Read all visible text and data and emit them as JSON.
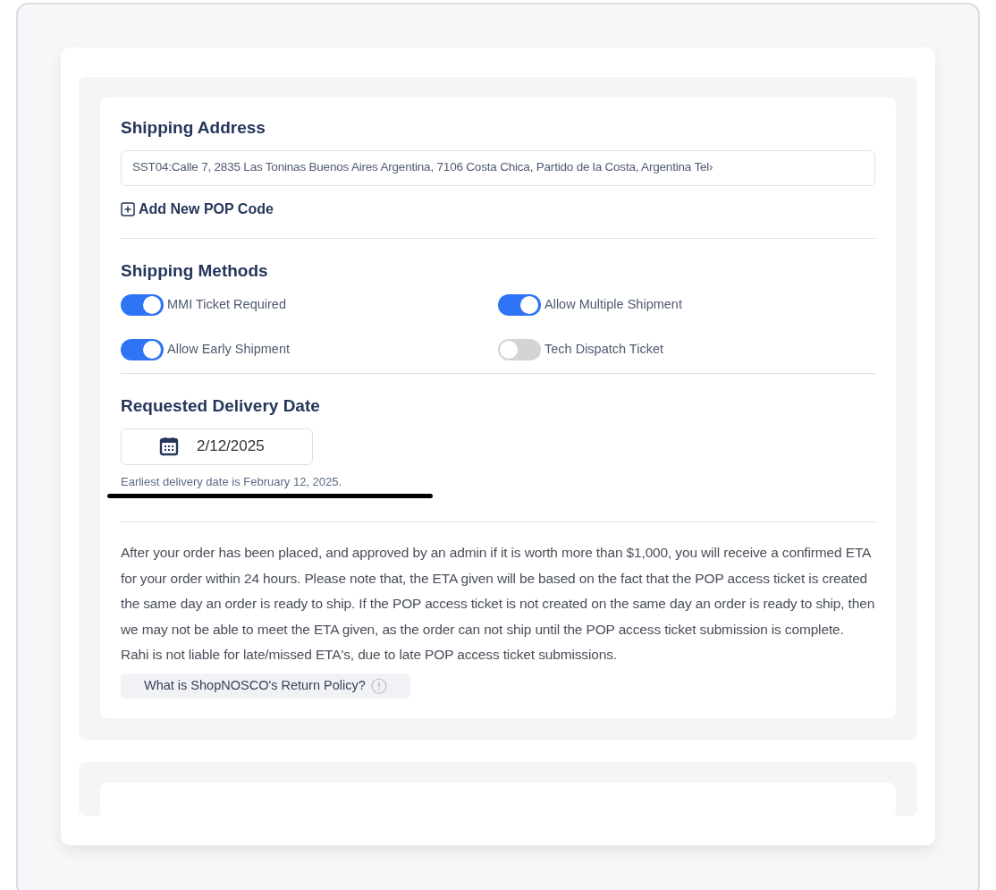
{
  "shipping_address": {
    "title": "Shipping Address",
    "value": "SST04:Calle 7, 2835 Las Toninas Buenos Aires Argentina, 7106 Costa Chica, Partido de la Costa, Argentina Tel›",
    "add_link": "Add New POP Code"
  },
  "shipping_methods": {
    "title": "Shipping Methods",
    "options": [
      {
        "label": "MMI Ticket Required",
        "on": true
      },
      {
        "label": "Allow Multiple Shipment",
        "on": true
      },
      {
        "label": "Allow Early Shipment",
        "on": true
      },
      {
        "label": "Tech Dispatch Ticket",
        "on": false
      }
    ]
  },
  "delivery_date": {
    "title": "Requested Delivery Date",
    "value": "2/12/2025",
    "hint": "Earliest delivery date is February 12, 2025."
  },
  "notice": "After your order has been placed, and approved by an admin if it is worth more than $1,000, you will receive a confirmed ETA for your order within 24 hours. Please note that, the ETA given will be based on the fact that the POP access ticket is created the same day an order is ready to ship. If the POP access ticket is not created on the same day an order is ready to ship, then we may not be able to meet the ETA given, as the order can not ship until the POP access ticket submission is complete. Rahi is not liable for late/missed ETA's, due to late POP access ticket submissions.",
  "return_policy_button": "What is ShopNOSCO's Return Policy?"
}
